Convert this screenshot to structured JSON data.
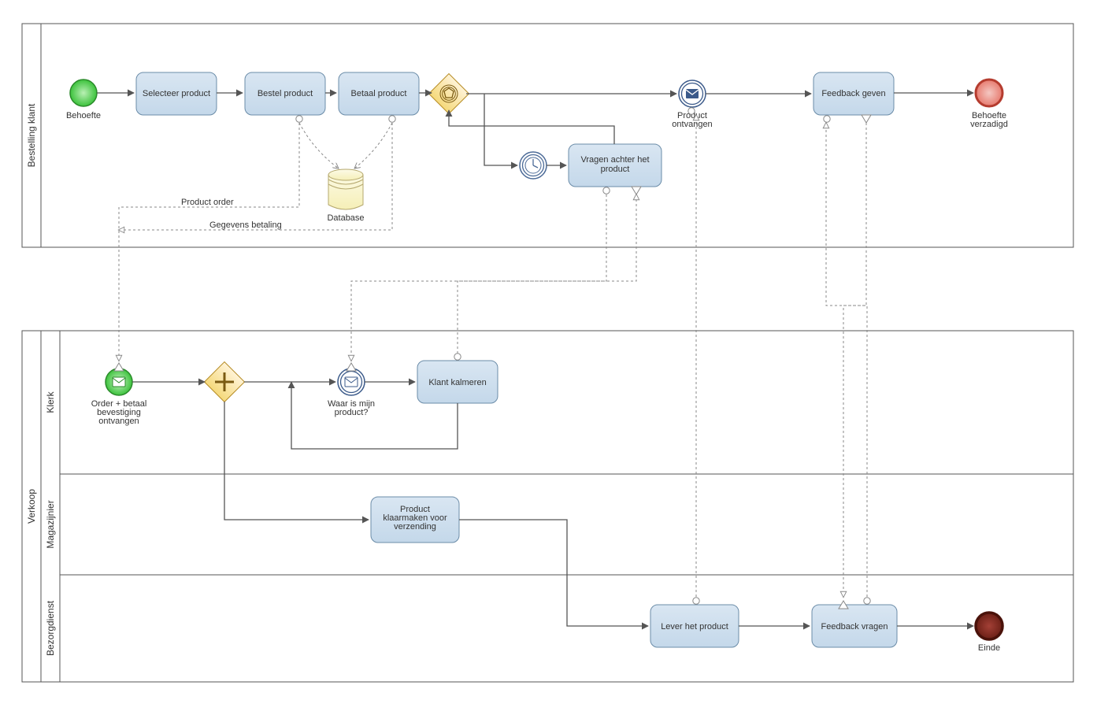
{
  "pools": {
    "top": {
      "name": "Bestelling klant"
    },
    "bottom": {
      "name": "Verkoop",
      "lanes": [
        "Klerk",
        "Magazijnier",
        "Bezorgdienst"
      ]
    }
  },
  "events": {
    "startNeed": "Behoefte",
    "endNeed": "Behoefte\nverzadigd",
    "productRecv": "Product\nontvangen",
    "orderRecv": "Order + betaal\nbevestiging\nontvangen",
    "whereProduct": "Waar is mijn\nproduct?",
    "end2": "Einde"
  },
  "tasks": {
    "select": "Selecteer product",
    "order": "Bestel product",
    "pay": "Betaal product",
    "ask": "Vragen achter het\nproduct",
    "feedback": "Feedback geven",
    "calm": "Klant kalmeren",
    "prep": "Product\nklaarmaken voor\nverzending",
    "deliver": "Lever het product",
    "askFb": "Feedback vragen"
  },
  "data": {
    "db": "Database"
  },
  "messages": {
    "orderMsg": "Product order",
    "payMsg": "Gegevens betaling"
  }
}
